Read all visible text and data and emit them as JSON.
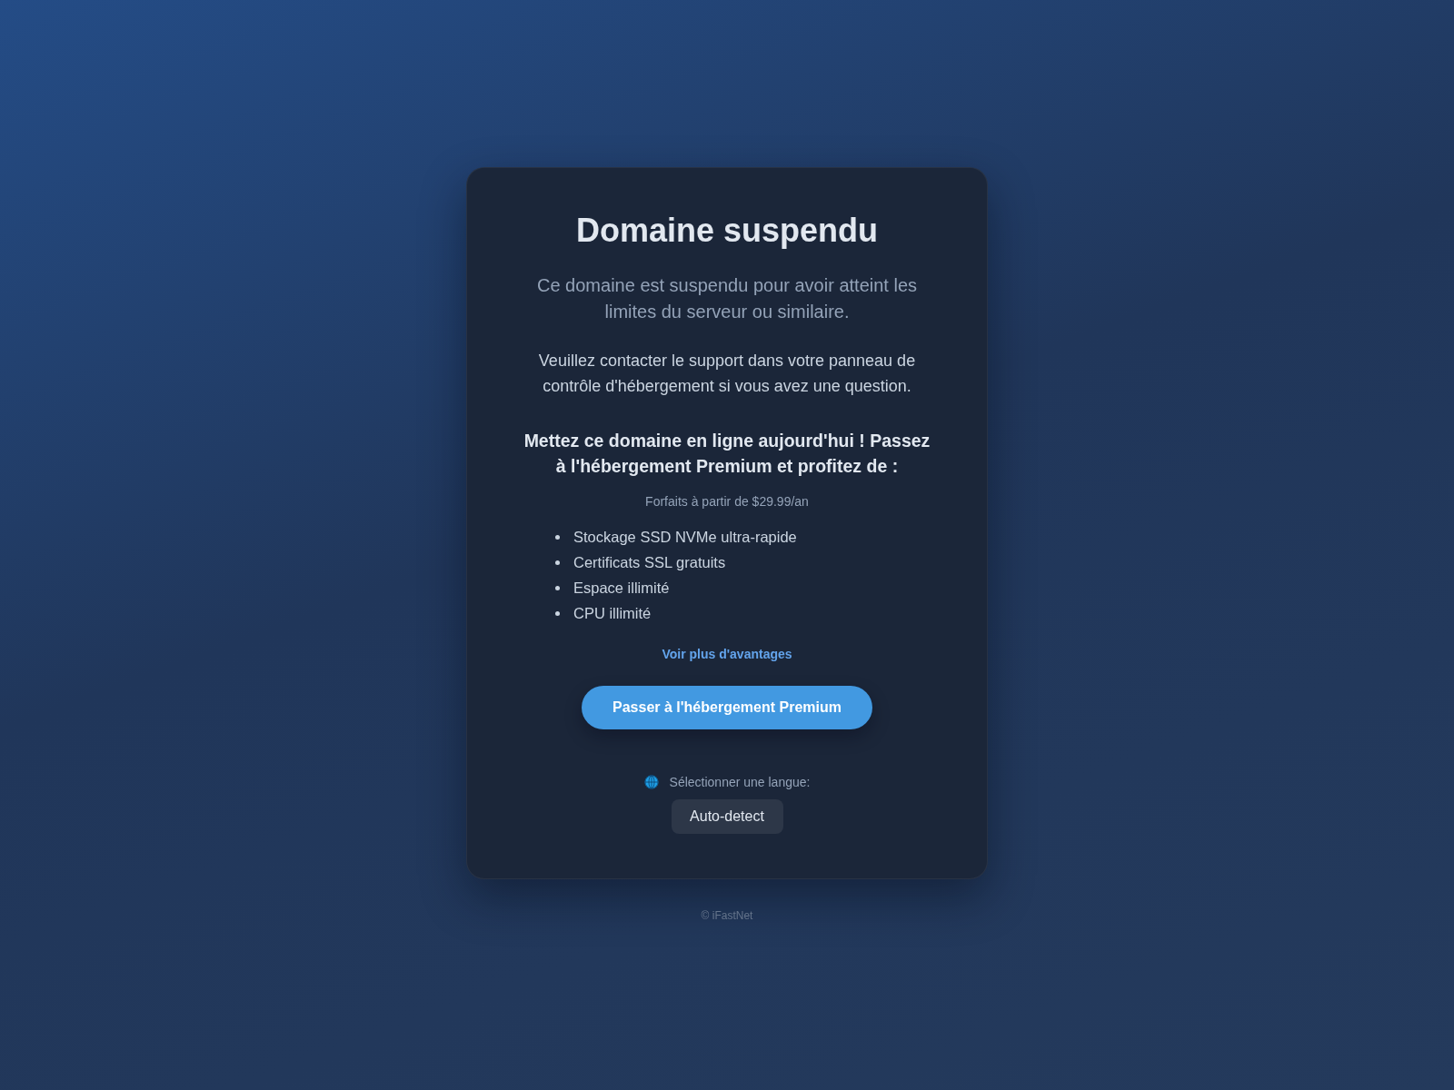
{
  "notice": {
    "title": "Domaine suspendu",
    "subtitle": "Ce domaine est suspendu pour avoir atteint les limites du serveur ou similaire.",
    "message": "Veuillez contacter le support dans votre panneau de contrôle d'hébergement si vous avez une question."
  },
  "promo": {
    "heading": "Mettez ce domaine en ligne aujourd'hui ! Passez à l'hébergement Premium et profitez de :",
    "price_note": "Forfaits à partir de $29.99/an",
    "features": [
      "Stockage SSD NVMe ultra-rapide",
      "Certificats SSL gratuits",
      "Espace illimité",
      "CPU illimité"
    ],
    "more_link": "Voir plus d'avantages",
    "upgrade_button": "Passer à l'hébergement Premium"
  },
  "language": {
    "label": "Sélectionner une langue:",
    "value": "Auto-detect"
  },
  "footer": "© iFastNet"
}
